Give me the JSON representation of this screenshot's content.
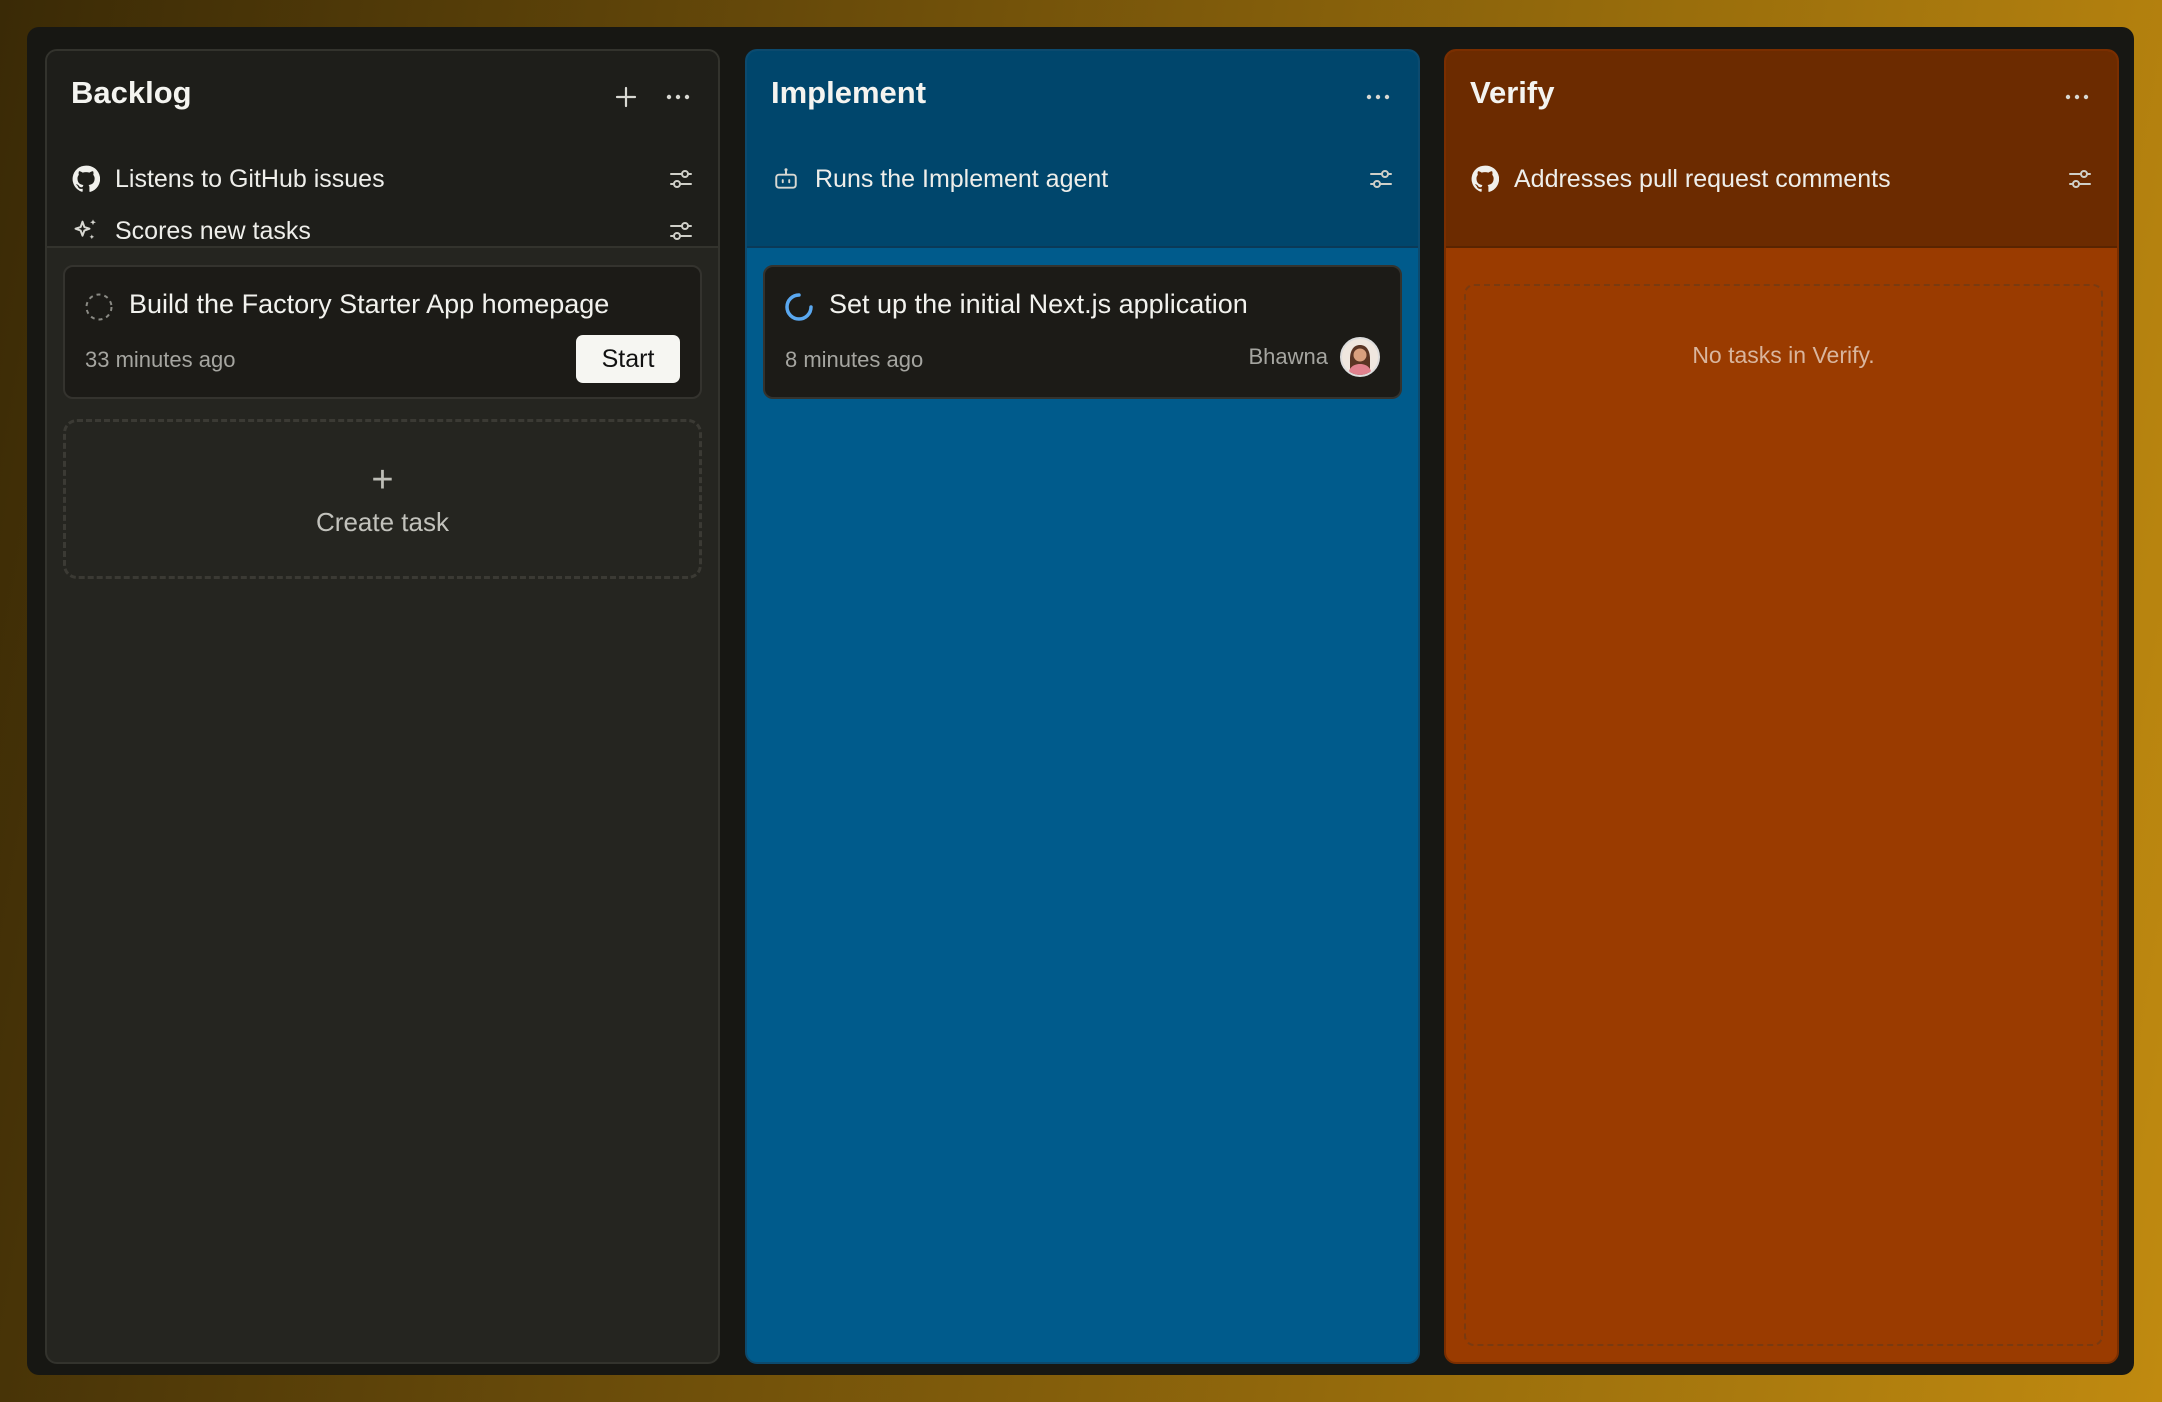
{
  "columns": {
    "backlog": {
      "title": "Backlog",
      "rules": [
        {
          "icon": "github-icon",
          "label": "Listens to GitHub issues"
        },
        {
          "icon": "sparkle-icon",
          "label": "Scores new tasks"
        }
      ],
      "card": {
        "title": "Build the Factory Starter App homepage",
        "time": "33 minutes ago",
        "action_label": "Start"
      },
      "create_task": {
        "plus": "+",
        "label": "Create task"
      }
    },
    "implement": {
      "title": "Implement",
      "rules": [
        {
          "icon": "robot-icon",
          "label": "Runs the Implement agent"
        }
      ],
      "card": {
        "title": "Set up the initial Next.js application",
        "time": "8 minutes ago",
        "assignee": "Bhawna"
      }
    },
    "verify": {
      "title": "Verify",
      "rules": [
        {
          "icon": "github-icon",
          "label": "Addresses pull request comments"
        }
      ],
      "empty": "No tasks in Verify."
    }
  },
  "colors": {
    "backlog_bg": "#252520",
    "implement_bg": "#005b8c",
    "verify_bg": "#9a3b00",
    "spinner": "#5aa8f0"
  }
}
